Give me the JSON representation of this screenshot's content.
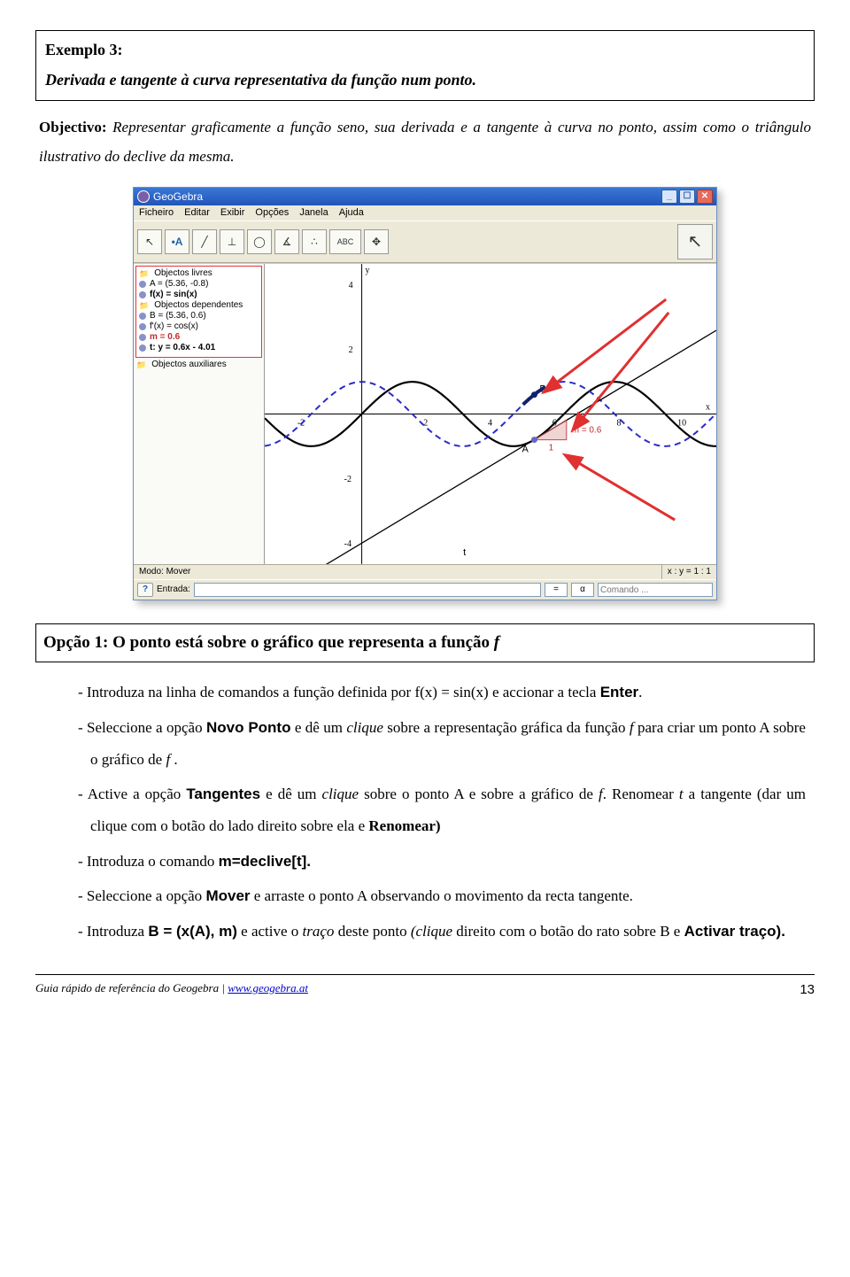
{
  "example": {
    "label": "Exemplo 3:",
    "subtitle": "Derivada e tangente à curva representativa da função num ponto."
  },
  "objective": {
    "label": "Objectivo:",
    "text": "Representar graficamente a função seno, sua derivada e a tangente à curva no ponto, assim como o triângulo ilustrativo do declive da mesma."
  },
  "window": {
    "title": "GeoGebra",
    "menu": [
      "Ficheiro",
      "Editar",
      "Exibir",
      "Opções",
      "Janela",
      "Ajuda"
    ],
    "toolbar_text": "ABC",
    "big_tool": "↖",
    "algebra": {
      "sections": [
        {
          "folder": "Objectos livres",
          "items": [
            {
              "icon": true,
              "text": "A = (5.36, -0.8)",
              "cls": ""
            },
            {
              "icon": true,
              "text": "f(x) = sin(x)",
              "cls": "bold"
            }
          ]
        },
        {
          "folder": "Objectos dependentes",
          "items": [
            {
              "icon": true,
              "text": "B = (5.36, 0.6)",
              "cls": ""
            },
            {
              "icon": true,
              "text": "f'(x) = cos(x)",
              "cls": ""
            },
            {
              "icon": true,
              "text": "m = 0.6",
              "cls": "alg-red"
            },
            {
              "icon": true,
              "text": "t: y = 0.6x - 4.01",
              "cls": "bold"
            }
          ]
        },
        {
          "folder": "Objectos auxiliares",
          "items": []
        }
      ]
    },
    "canvas": {
      "x_axis_label": "x",
      "y_axis_label": "y",
      "x_ticks": [
        -2,
        2,
        4,
        6,
        8,
        10
      ],
      "y_ticks": [
        -4,
        -2,
        2,
        4
      ],
      "point_A_label": "A",
      "point_B_label": "B",
      "slope_label": "m = 0.6",
      "tangent_label": "t",
      "triangle_base": "1"
    },
    "status_mode": "Modo: Mover",
    "status_ratio": "x : y = 1 : 1",
    "input_label": "Entrada:",
    "input_value": "",
    "small1": "=",
    "small2": "α",
    "cmd_placeholder": "Comando ..."
  },
  "option1": {
    "title_prefix": "Opção 1: O ponto está sobre o gráfico que representa a função ",
    "f_symbol": "f"
  },
  "steps": {
    "s1a": "- Introduza na linha de comandos a função definida por f(x) = sin(x) e accionar a tecla ",
    "s1b": "Enter",
    "s1c": ".",
    "s2a": "- Seleccione a opção ",
    "s2b": "Novo Ponto",
    "s2c": " e dê um ",
    "s2d": "clique",
    "s2e": " sobre a representação gráfica da função ",
    "s2f": "f",
    "s2g": "  para criar um ponto A sobre o gráfico de ",
    "s2h": "f",
    "s2i": " .",
    "s3a": "- Active a opção ",
    "s3b": "Tangentes",
    "s3c": " e dê um ",
    "s3d": "clique",
    "s3e": " sobre o ponto A e sobre a gráfico de ",
    "s3f": "f",
    "s3g": ". Renomear ",
    "s3h": "t",
    "s3i": " a tangente (dar um clique com o botão do lado direito sobre ela e ",
    "s3j": "Renomear)",
    "s4a": "- Introduza o comando ",
    "s4b": "m=declive[t].",
    "s5a": "- Seleccione a opção ",
    "s5b": "Mover",
    "s5c": " e arraste o ponto A observando o movimento da recta tangente.",
    "s6a": "- Introduza ",
    "s6b": "B = (x(A), m)",
    "s6c": " e active o ",
    "s6d": "traço",
    "s6e": " deste ponto ",
    "s6f": "(clique",
    "s6g": " direito com o botão do rato  sobre B e ",
    "s6h": "Activar traço).",
    "renomear": "Renomear)"
  },
  "footer": {
    "left_a": "Guia rápido de referência do Geogebra | ",
    "link": "www.geogebra.at",
    "page": "13"
  },
  "chart_data": {
    "type": "line",
    "series": [
      {
        "name": "f(x)=sin(x)",
        "formula": "sin(x)",
        "color": "#000",
        "style": "solid"
      },
      {
        "name": "f'(x)=cos(x)",
        "formula": "cos(x)",
        "color": "#2a2ab0",
        "style": "dashed"
      },
      {
        "name": "t (tangent)",
        "formula": "0.6*x - 4.01",
        "color": "#000",
        "style": "solid-thin"
      }
    ],
    "points": [
      {
        "name": "A",
        "x": 5.36,
        "y": -0.8,
        "color": "#6666cc"
      },
      {
        "name": "B",
        "x": 5.36,
        "y": 0.6,
        "color": "#112255"
      }
    ],
    "slope_triangle": {
      "at_x": 5.36,
      "at_y": -0.8,
      "base": 1,
      "rise": 0.6,
      "label": "m = 0.6"
    },
    "xlim": [
      -3,
      11
    ],
    "ylim": [
      -5,
      5
    ],
    "x_ticks": [
      -2,
      0,
      2,
      4,
      6,
      8,
      10
    ],
    "y_ticks": [
      -4,
      -2,
      0,
      2,
      4
    ],
    "title": "",
    "xlabel": "x",
    "ylabel": "y"
  }
}
